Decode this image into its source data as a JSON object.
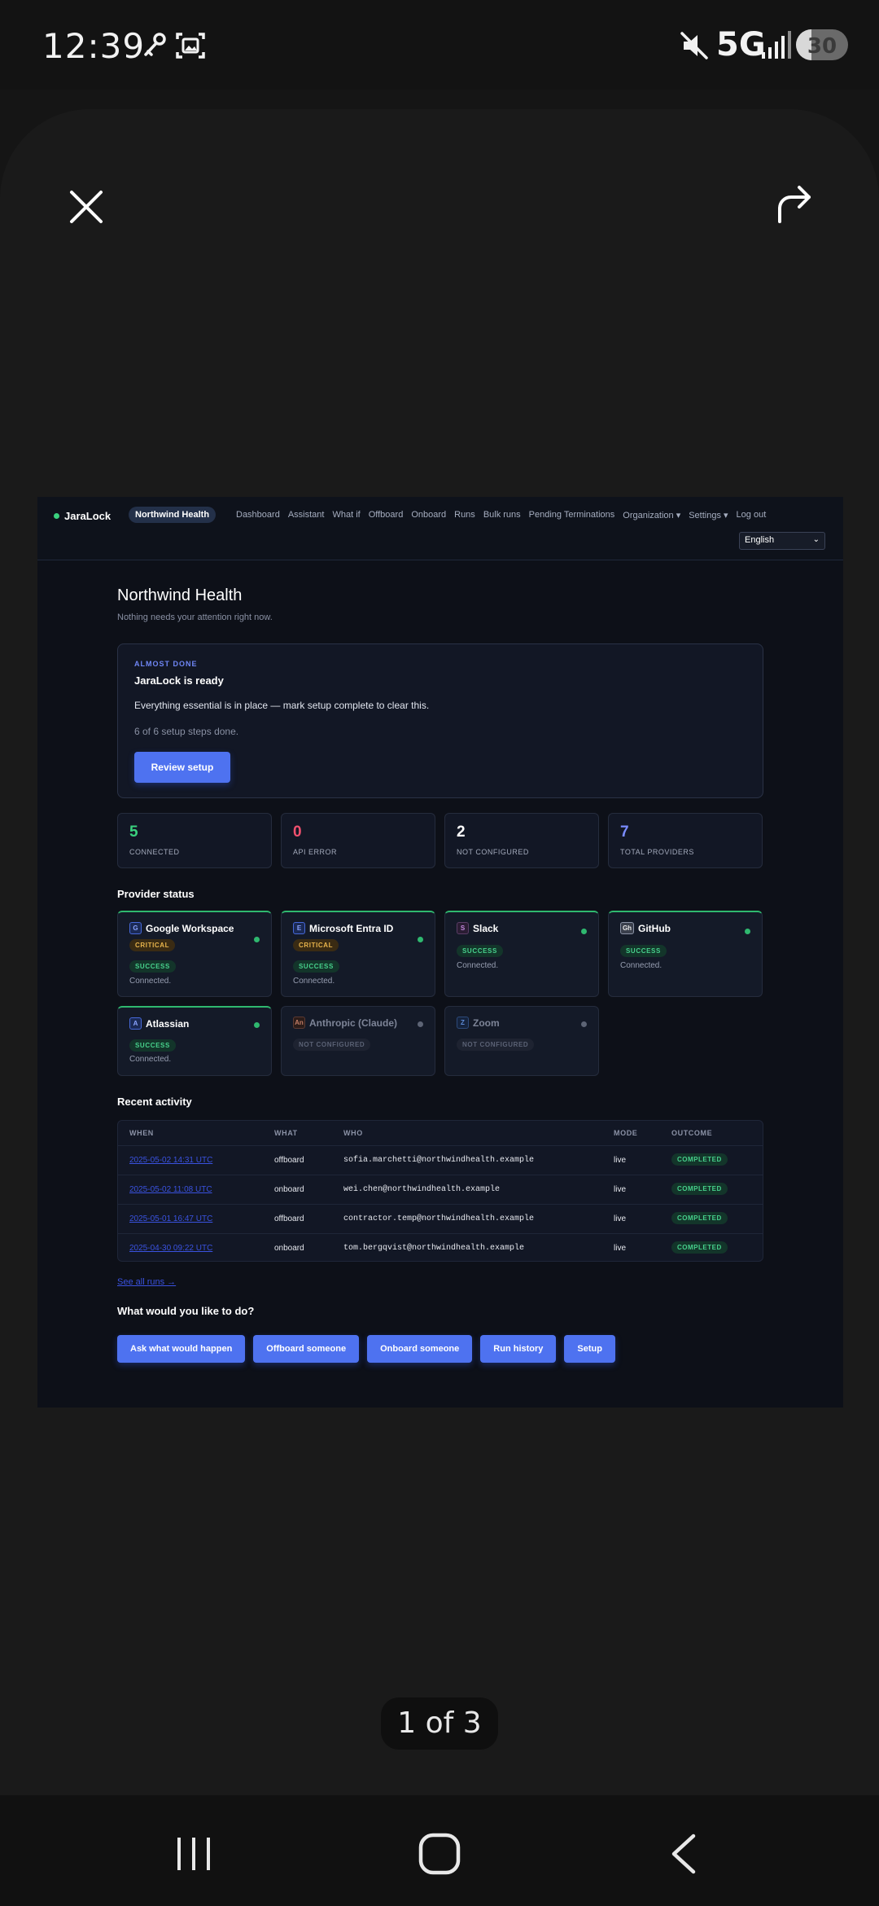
{
  "status_bar": {
    "time": "12:39",
    "network": "5G",
    "battery": "30",
    "battery_level": 0.3,
    "icons": [
      "key-icon",
      "screenshot-icon",
      "mute-icon",
      "signal-icon"
    ]
  },
  "viewer": {
    "counter": "1 of 3",
    "close_icon": "close-icon",
    "share_icon": "share-icon"
  },
  "app": {
    "brand": "JaraLock",
    "org": "Northwind Health",
    "nav": [
      "Dashboard",
      "Assistant",
      "What if",
      "Offboard",
      "Onboard",
      "Runs",
      "Bulk runs",
      "Pending Terminations",
      "Organization ▾",
      "Settings ▾",
      "Log out"
    ],
    "language": "English",
    "page_title": "Northwind Health",
    "page_subtitle": "Nothing needs your attention right now.",
    "setup": {
      "kicker": "ALMOST DONE",
      "title": "JaraLock is ready",
      "description": "Everything essential is in place — mark setup complete to clear this.",
      "steps": "6 of 6 setup steps done.",
      "button": "Review setup"
    },
    "stats": [
      {
        "value": "5",
        "label": "CONNECTED",
        "color": "#3ad17e"
      },
      {
        "value": "0",
        "label": "API ERROR",
        "color": "#f0506e"
      },
      {
        "value": "2",
        "label": "NOT CONFIGURED",
        "color": "#ffffff"
      },
      {
        "value": "7",
        "label": "TOTAL PROVIDERS",
        "color": "#7a8cff"
      }
    ],
    "provider_heading": "Provider status",
    "providers": [
      {
        "name": "Google Workspace",
        "icon": "G",
        "critical": "CRITICAL",
        "status": "SUCCESS",
        "note": "Connected."
      },
      {
        "name": "Microsoft Entra ID",
        "icon": "E",
        "critical": "CRITICAL",
        "status": "SUCCESS",
        "note": "Connected."
      },
      {
        "name": "Slack",
        "icon": "S",
        "status": "SUCCESS",
        "note": "Connected."
      },
      {
        "name": "GitHub",
        "icon": "Gh",
        "status": "SUCCESS",
        "note": "Connected."
      },
      {
        "name": "Atlassian",
        "icon": "A",
        "status": "SUCCESS",
        "note": "Connected."
      },
      {
        "name": "Anthropic (Claude)",
        "icon": "An",
        "status": "NOT CONFIGURED"
      },
      {
        "name": "Zoom",
        "icon": "Z",
        "status": "NOT CONFIGURED"
      }
    ],
    "activity_heading": "Recent activity",
    "activity_columns": [
      "WHEN",
      "WHAT",
      "WHO",
      "MODE",
      "OUTCOME"
    ],
    "activity_rows": [
      {
        "when": "2025-05-02 14:31 UTC",
        "what": "offboard",
        "who": "sofia.marchetti@northwindhealth.example",
        "mode": "live",
        "outcome": "COMPLETED"
      },
      {
        "when": "2025-05-02 11:08 UTC",
        "what": "onboard",
        "who": "wei.chen@northwindhealth.example",
        "mode": "live",
        "outcome": "COMPLETED"
      },
      {
        "when": "2025-05-01 16:47 UTC",
        "what": "offboard",
        "who": "contractor.temp@northwindhealth.example",
        "mode": "live",
        "outcome": "COMPLETED"
      },
      {
        "when": "2025-04-30 09:22 UTC",
        "what": "onboard",
        "who": "tom.bergqvist@northwindhealth.example",
        "mode": "live",
        "outcome": "COMPLETED"
      }
    ],
    "see_all": "See all runs →",
    "actions_heading": "What would you like to do?",
    "actions": [
      "Ask what would happen",
      "Offboard someone",
      "Onboard someone",
      "Run history",
      "Setup"
    ]
  }
}
